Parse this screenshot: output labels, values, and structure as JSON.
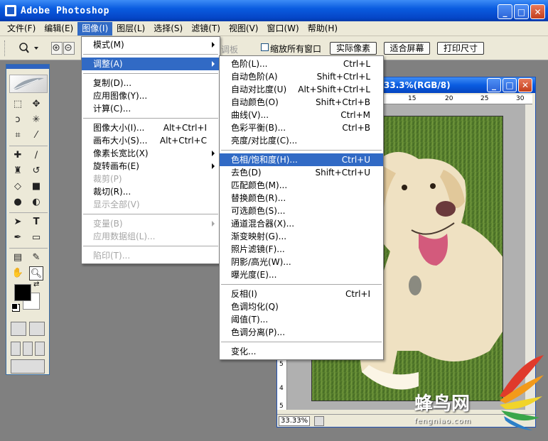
{
  "app": {
    "title": "Adobe Photoshop"
  },
  "menubar": [
    {
      "label": "文件(F)"
    },
    {
      "label": "编辑(E)"
    },
    {
      "label": "图像(I)"
    },
    {
      "label": "图层(L)"
    },
    {
      "label": "选择(S)"
    },
    {
      "label": "滤镜(T)"
    },
    {
      "label": "视图(V)"
    },
    {
      "label": "窗口(W)"
    },
    {
      "label": "帮助(H)"
    }
  ],
  "options": {
    "behind_label": "调板",
    "fit_all_label": "缩放所有窗口",
    "actual_pixels": "实际像素",
    "fit_screen": "适合屏幕",
    "print_size": "打印尺寸"
  },
  "image_menu": [
    {
      "label": "模式(M)",
      "submenu": true
    },
    {
      "sep": true
    },
    {
      "label": "调整(A)",
      "submenu": true,
      "highlight": true
    },
    {
      "sep": true
    },
    {
      "label": "复制(D)..."
    },
    {
      "label": "应用图像(Y)..."
    },
    {
      "label": "计算(C)..."
    },
    {
      "sep": true
    },
    {
      "label": "图像大小(I)...",
      "shortcut": "Alt+Ctrl+I"
    },
    {
      "label": "画布大小(S)...",
      "shortcut": "Alt+Ctrl+C"
    },
    {
      "label": "像素长宽比(X)",
      "submenu": true
    },
    {
      "label": "旋转画布(E)",
      "submenu": true
    },
    {
      "label": "裁剪(P)",
      "disabled": true
    },
    {
      "label": "裁切(R)..."
    },
    {
      "label": "显示全部(V)",
      "disabled": true
    },
    {
      "sep": true
    },
    {
      "label": "变量(B)",
      "submenu": true,
      "disabled": true
    },
    {
      "label": "应用数据组(L)...",
      "disabled": true
    },
    {
      "sep": true
    },
    {
      "label": "陷印(T)...",
      "disabled": true
    }
  ],
  "adjust_menu": [
    {
      "label": "色阶(L)...",
      "shortcut": "Ctrl+L"
    },
    {
      "label": "自动色阶(A)",
      "shortcut": "Shift+Ctrl+L"
    },
    {
      "label": "自动对比度(U)",
      "shortcut": "Alt+Shift+Ctrl+L"
    },
    {
      "label": "自动颜色(O)",
      "shortcut": "Shift+Ctrl+B"
    },
    {
      "label": "曲线(V)...",
      "shortcut": "Ctrl+M"
    },
    {
      "label": "色彩平衡(B)...",
      "shortcut": "Ctrl+B"
    },
    {
      "label": "亮度/对比度(C)..."
    },
    {
      "sep": true
    },
    {
      "label": "色相/饱和度(H)...",
      "shortcut": "Ctrl+U",
      "highlight": true
    },
    {
      "label": "去色(D)",
      "shortcut": "Shift+Ctrl+U"
    },
    {
      "label": "匹配颜色(M)..."
    },
    {
      "label": "替换颜色(R)..."
    },
    {
      "label": "可选颜色(S)..."
    },
    {
      "label": "通道混合器(X)..."
    },
    {
      "label": "渐变映射(G)..."
    },
    {
      "label": "照片滤镜(F)..."
    },
    {
      "label": "阴影/高光(W)..."
    },
    {
      "label": "曝光度(E)..."
    },
    {
      "sep": true
    },
    {
      "label": "反相(I)",
      "shortcut": "Ctrl+I"
    },
    {
      "label": "色调均化(Q)"
    },
    {
      "label": "阈值(T)..."
    },
    {
      "label": "色调分离(P)..."
    },
    {
      "sep": true
    },
    {
      "label": "变化..."
    }
  ],
  "document": {
    "title": "33.3%(RGB/8)",
    "zoom": "33.33%",
    "ruler_h": [
      "15",
      "20",
      "25",
      "30"
    ],
    "ruler_v": [
      "5",
      "4",
      "5"
    ]
  },
  "watermark": {
    "main": "蜂鸟网",
    "sub": "fengniao.com"
  },
  "colors": {
    "title_blue": "#0a5ce0",
    "highlight": "#316ac5",
    "menubar_bg": "#ece9d8"
  }
}
